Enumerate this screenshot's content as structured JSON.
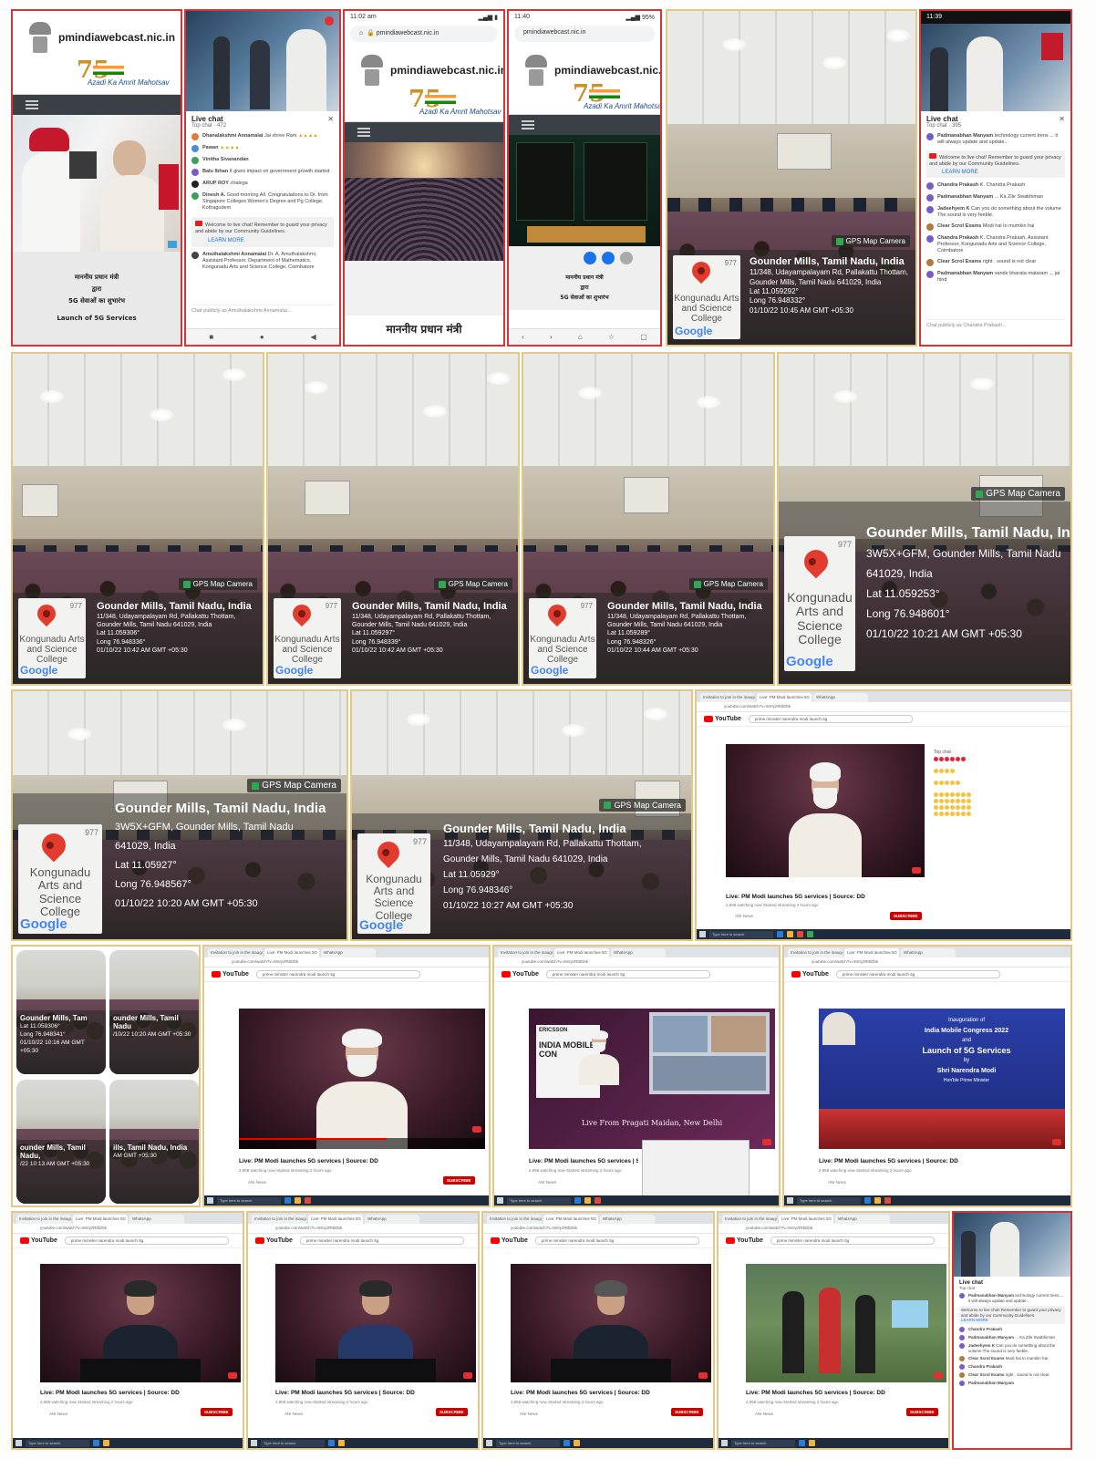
{
  "site": {
    "domain": "pmindiawebcast.nic.in",
    "azadi_number": "75",
    "azadi_text": "Azadi Ka Amrit Mahotsav"
  },
  "phone_hindi": {
    "line1": "माननीय प्रधान मंत्री",
    "line2": "द्वारा",
    "line3": "5G सेवाओं का शुभारंभ",
    "launch": "Launch of 5G Services",
    "big": "माननीय प्रधान मंत्री"
  },
  "chat": {
    "title": "Live chat",
    "top": "Top chat",
    "count": "472",
    "welcome": "Welcome to live chat! Remember to guard your privacy and abide by our Community Guidelines.",
    "learn_more": "LEARN MORE",
    "placeholder": "Chat publicly as Amuthalakshmi Annamalai...",
    "messages": [
      {
        "name": "Dhanalakshmi Annamalai",
        "text": "Jai shree Ram",
        "color": "#e07b39"
      },
      {
        "name": "Pawan",
        "text": "",
        "color": "#4a8fd6"
      },
      {
        "name": "Vinitha Sivanandan",
        "text": "",
        "color": "#3a9e5f"
      },
      {
        "name": "Balu Ibhan",
        "text": "It gives impact on government growth started",
        "color": "#7a5bc6"
      },
      {
        "name": "ARUP ROY",
        "text": "chalega",
        "color": "#222"
      },
      {
        "name": "Dinesh A.",
        "text": "Good morning All. Congratulations to Dr. from Singapore Colleges Women's Degree and Pg College, Kothagudem",
        "color": "#3a9e5f"
      },
      {
        "name": "Amuthalakshmi Annamalai",
        "text": "Dr. A. Amuthalakshmi, Assistant Professor, Department of Mathematics, Kongunadu Arts and Science College, Coimbatore",
        "color": "#444"
      }
    ]
  },
  "chat2": {
    "title": "Live chat",
    "top": "Top chat",
    "count": "395",
    "messages": [
      {
        "name": "Padmanabhan Manyam",
        "text": "technology current trens ... it will always update and update..."
      },
      {
        "name": "Chandra Prakash",
        "text": "K. Chandra Prakash"
      },
      {
        "name": "Padmanabhan Manyam",
        "text": "... Ka Zile Swabhiman"
      },
      {
        "name": "Jadeehyem K",
        "text": "Can you do something about the volume The sound is very feeble."
      },
      {
        "name": "Clear Scrol Exams",
        "text": "Modi hai to mumkin hai"
      },
      {
        "name": "Chandra Prakash",
        "text": "K. Chandra Prakash, Assistant Professor, Kongunadu Arts and Science College, Coimbatore"
      },
      {
        "name": "Clear Scrol Exams",
        "text": "right . sound is not clear"
      },
      {
        "name": "Padmanabhan Manyam",
        "text": "vande bharata mataram ... jai hind"
      }
    ],
    "placeholder": "Chat publicly as Chandra Prakash..."
  },
  "phone_status": {
    "time1": "11:02 am",
    "time2": "11:40",
    "time3": "11:39"
  },
  "gps": {
    "badge": "GPS Map Camera",
    "map_college": "Kongunadu Arts and Science College",
    "map_brand": "Google",
    "map_num": "977",
    "title": "Gounder Mills, Tamil Nadu, India",
    "entries": [
      {
        "addr1": "11/348, Udayampalayam Rd, Pallakattu Thottam,",
        "addr2": "Gounder Mills, Tamil Nadu 641029, India",
        "lat": "Lat 11.059292°",
        "long": "Long 76.948332°",
        "time": "01/10/22 10:45 AM GMT +05:30"
      },
      {
        "addr1": "11/348, Udayampalayam Rd, Pallakattu Thottam,",
        "addr2": "Gounder Mills, Tamil Nadu 641029, India",
        "lat": "Lat 11.059306°",
        "long": "Long 76.948336°",
        "time": "01/10/22 10:42 AM GMT +05:30"
      },
      {
        "addr1": "11/348, Udayampalayam Rd, Pallakattu Thottam,",
        "addr2": "Gounder Mills, Tamil Nadu 641029, India",
        "lat": "Lat 11.059297°",
        "long": "Long 76.948339°",
        "time": "01/10/22 10:42 AM GMT +05:30"
      },
      {
        "addr1": "11/348, Udayampalayam Rd, Pallakattu Thottam,",
        "addr2": "Gounder Mills, Tamil Nadu 641029, India",
        "lat": "Lat 11.059289°",
        "long": "Long 76.948326°",
        "time": "01/10/22 10:44 AM GMT +05:30"
      },
      {
        "addr1": "3W5X+GFM, Gounder Mills, Tamil Nadu",
        "addr2": "641029, India",
        "lat": "Lat 11.059253°",
        "long": "Long 76.948601°",
        "time": "01/10/22 10:21 AM GMT +05:30"
      },
      {
        "addr1": "3W5X+GFM, Gounder Mills, Tamil Nadu",
        "addr2": "641029, India",
        "lat": "Lat 11.05927°",
        "long": "Long 76.948567°",
        "time": "01/10/22 10:20 AM GMT +05:30"
      },
      {
        "addr1": "11/348, Udayampalayam Rd, Pallakattu Thottam,",
        "addr2": "Gounder Mills, Tamil Nadu 641029, India",
        "lat": "Lat 11.05929°",
        "long": "Long 76.948346°",
        "time": "01/10/22 10:27 AM GMT +05:30"
      }
    ]
  },
  "youtube": {
    "brand": "YouTube",
    "search": "prime minister narendra modi launch 5g",
    "title": "Live: PM Modi launches 5G services | Source: DD",
    "meta": "2,958 watching now  Started streaming 2 hours ago",
    "channel": "ANI News",
    "subscribe": "SUBSCRIBE",
    "url": "youtube.com/watch?v=9mIyzRtbDbk",
    "tab1": "Invitation to join in the inaugura",
    "tab2": "Live: PM Modi launches 5G",
    "tab3": "WhatsApp",
    "taskbar_search": "Type here to search",
    "caption_live": "Live From Pragati Maidan, New Delhi",
    "imc_line1": "Inauguration of",
    "imc_line2": "India Mobile Congress 2022",
    "imc_line3": "and",
    "imc_line4": "Launch of 5G Services",
    "imc_line5": "by",
    "imc_line6": "Shri Narendra Modi",
    "imc_line7": "Hon'ble Prime Minister",
    "ericsson": "ERICSSON",
    "imc_short": "INDIA MOBILE CON"
  },
  "collage": {
    "t1": "Gounder Mills, Tam",
    "t2": "ounder Mills, Tamil Nadu",
    "t3": "ounder Mills, Tamil Nadu,",
    "t4": "ills, Tamil Nadu, India",
    "l1": "Lat 11.059306°",
    "l2": "Long 76.948341°",
    "d1": "01/10/22 10:16 AM GMT +05:30",
    "d2": "/10/22 10:20 AM GMT +05:30",
    "d3": "/22 10:13 AM GMT +05:30",
    "d4": "AM GMT +05:30"
  }
}
